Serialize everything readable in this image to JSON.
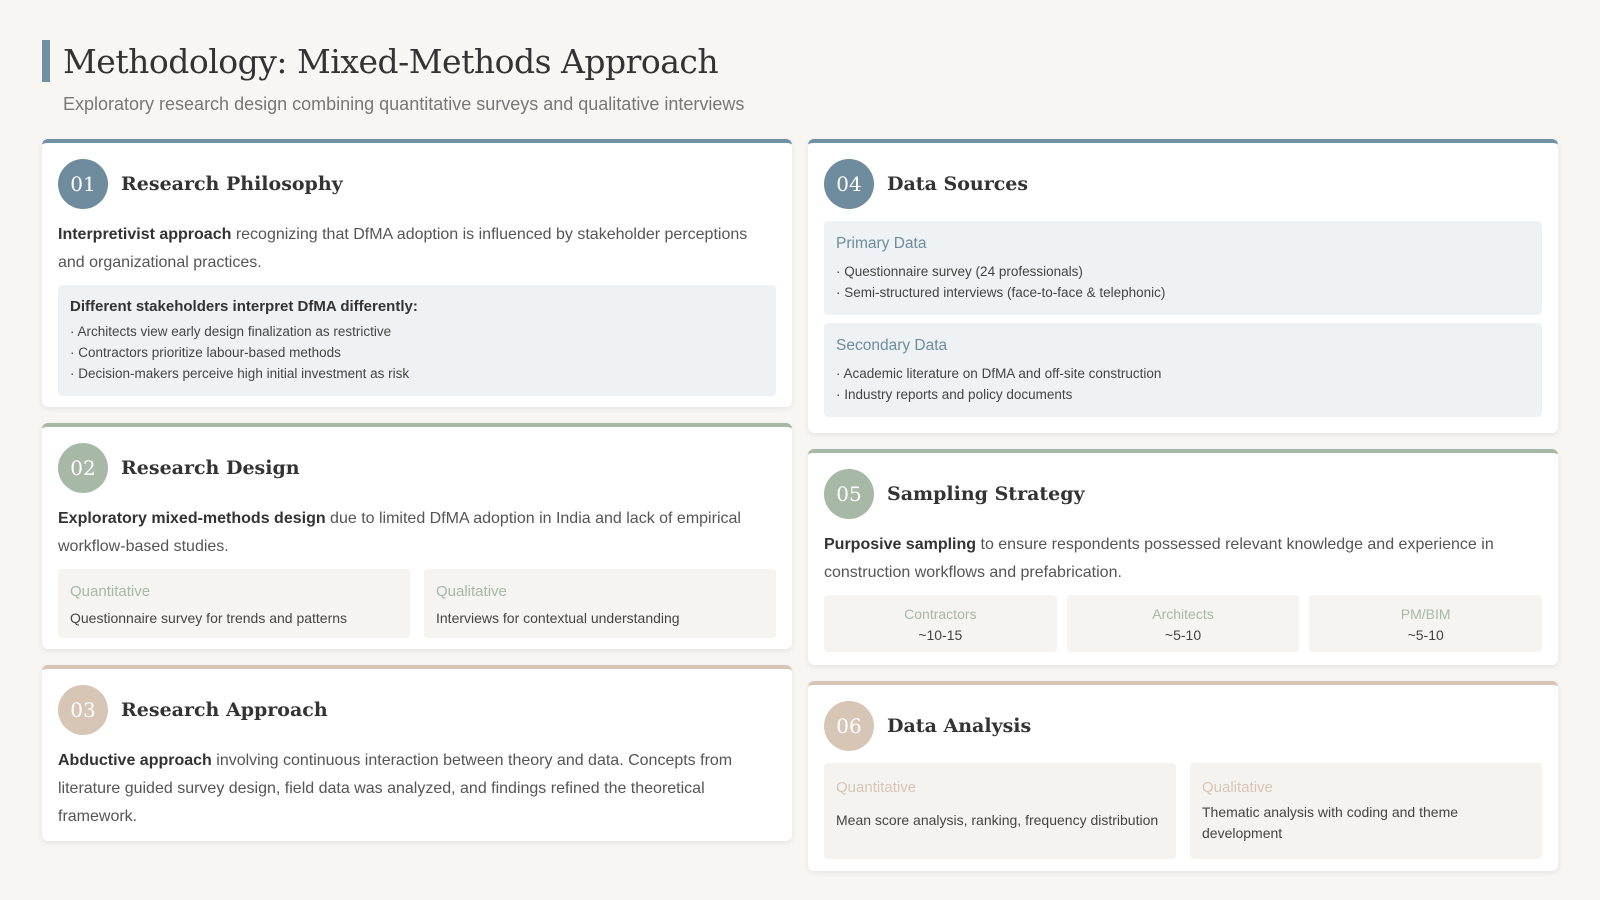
{
  "header": {
    "title": "Methodology: Mixed-Methods Approach",
    "subtitle": "Exploratory research design combining quantitative surveys and qualitative interviews"
  },
  "cards": {
    "philosophy": {
      "num": "01",
      "title": "Research Philosophy",
      "lead": "Interpretivist approach",
      "text": " recognizing that DfMA adoption is influenced by stakeholder perceptions and organizational practices.",
      "box_title": "Different stakeholders interpret DfMA differently:",
      "bullets": [
        "· Architects view early design finalization as restrictive",
        "· Contractors prioritize labour-based methods",
        "· Decision-makers perceive high initial investment as risk"
      ]
    },
    "design": {
      "num": "02",
      "title": "Research Design",
      "lead": "Exploratory mixed-methods design",
      "text": " due to limited DfMA adoption in India and lack of empirical workflow-based studies.",
      "quant_label": "Quantitative",
      "quant_text": "Questionnaire survey for trends and patterns",
      "qual_label": "Qualitative",
      "qual_text": "Interviews for contextual understanding"
    },
    "approach": {
      "num": "03",
      "title": "Research Approach",
      "lead": "Abductive approach",
      "text": " involving continuous interaction between theory and data. Concepts from literature guided survey design, field data was analyzed, and findings refined the theoretical framework."
    },
    "sources": {
      "num": "04",
      "title": "Data Sources",
      "primary_label": "Primary Data",
      "primary": [
        "· Questionnaire survey (24 professionals)",
        "· Semi-structured interviews (face-to-face & telephonic)"
      ],
      "secondary_label": "Secondary Data",
      "secondary": [
        "· Academic literature on DfMA and off-site construction",
        "· Industry reports and policy documents"
      ]
    },
    "sampling": {
      "num": "05",
      "title": "Sampling Strategy",
      "lead": "Purposive sampling",
      "text": " to ensure respondents possessed relevant knowledge and experience in construction workflows and prefabrication.",
      "stats": [
        {
          "label": "Contractors",
          "value": "~10-15"
        },
        {
          "label": "Architects",
          "value": "~5-10"
        },
        {
          "label": "PM/BIM",
          "value": "~5-10"
        }
      ]
    },
    "analysis": {
      "num": "06",
      "title": "Data Analysis",
      "quant_label": "Quantitative",
      "quant_text": "Mean score analysis, ranking, frequency distribution",
      "qual_label": "Qualitative",
      "qual_text": "Thematic analysis with coding and theme development"
    }
  }
}
